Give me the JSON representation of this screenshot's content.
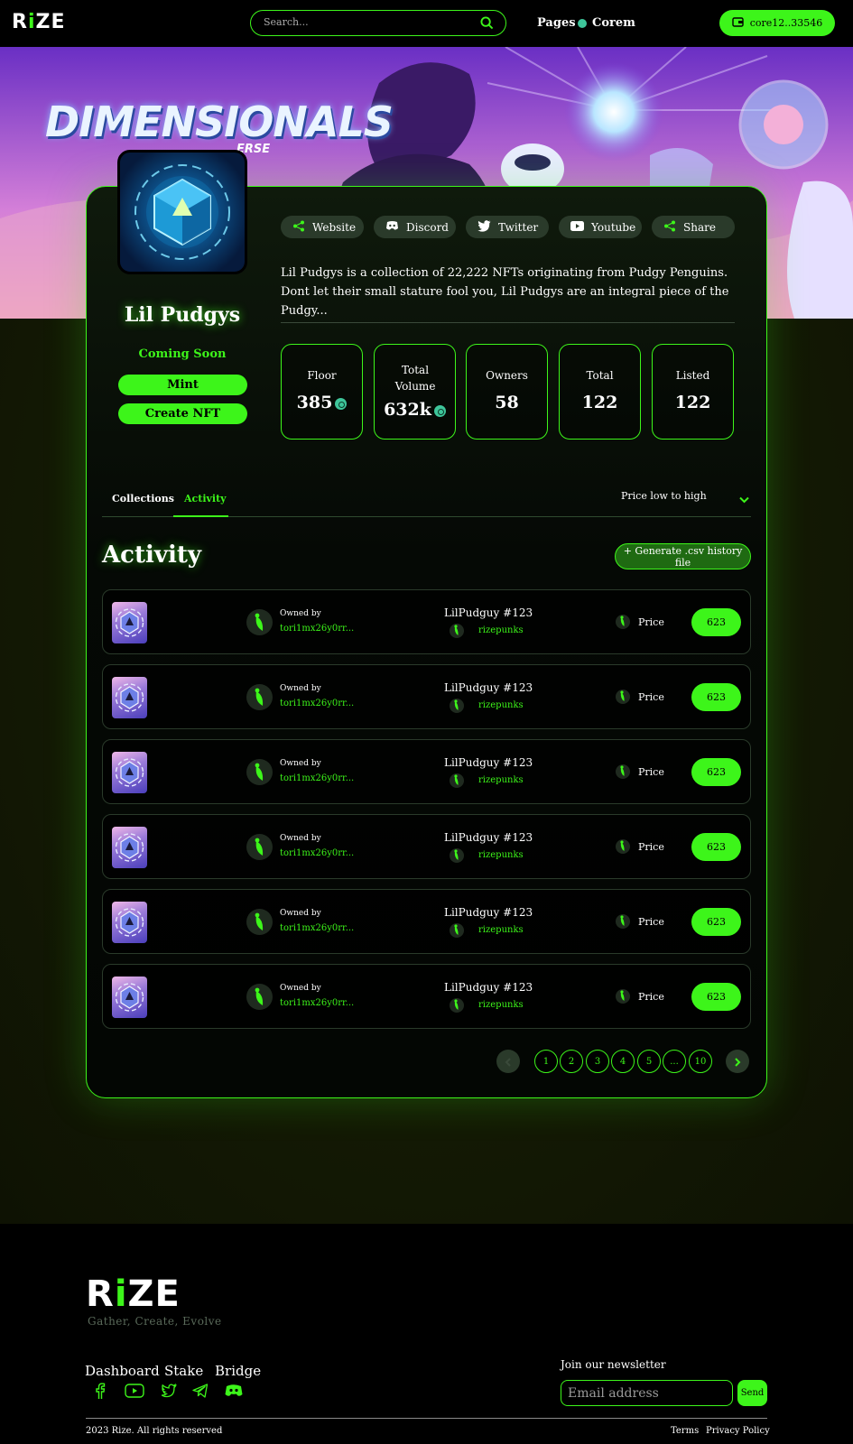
{
  "nav": {
    "logo": "RIZE",
    "search_placeholder": "Search...",
    "pages_label": "Pages",
    "network_label": "Corem",
    "wallet_label": "core12..33546"
  },
  "banner": {
    "title": "DIMENSIONALS",
    "subtitle": "ERSE"
  },
  "collection": {
    "name": "Lil Pudgys",
    "status": "Coming Soon",
    "mint_label": "Mint",
    "create_label": "Create NFT",
    "description": "Lil Pudgys is a collection of 22,222 NFTs originating from Pudgy Penguins. Dont let their small stature fool you, Lil Pudgys are an integral piece of the Pudgy..."
  },
  "social": [
    {
      "label": "Website",
      "icon": "share-icon"
    },
    {
      "label": "Discord",
      "icon": "discord-icon"
    },
    {
      "label": "Twitter",
      "icon": "twitter-icon"
    },
    {
      "label": "Youtube",
      "icon": "youtube-icon"
    },
    {
      "label": "Share",
      "icon": "share-icon"
    }
  ],
  "stats": [
    {
      "label": "Floor",
      "value": "385"
    },
    {
      "label": "Total Volume",
      "value": "632k"
    },
    {
      "label": "Owners",
      "value": "58"
    },
    {
      "label": "Total",
      "value": "122"
    },
    {
      "label": "Listed",
      "value": "122"
    }
  ],
  "tabs": [
    "Collections",
    "Activity"
  ],
  "active_tab": "Activity",
  "sort": {
    "selected": "Price low to high"
  },
  "activity": {
    "title": "Activity",
    "csv_button": "+ Generate .csv history file",
    "rows": [
      {
        "owned_label": "Owned by",
        "owner": "tori1mx26y0rr...",
        "item": "LilPudguy #123",
        "collection": "rizepunks",
        "price_label": "Price",
        "price": "623"
      },
      {
        "owned_label": "Owned by",
        "owner": "tori1mx26y0rr...",
        "item": "LilPudguy #123",
        "collection": "rizepunks",
        "price_label": "Price",
        "price": "623"
      },
      {
        "owned_label": "Owned by",
        "owner": "tori1mx26y0rr...",
        "item": "LilPudguy #123",
        "collection": "rizepunks",
        "price_label": "Price",
        "price": "623"
      },
      {
        "owned_label": "Owned by",
        "owner": "tori1mx26y0rr...",
        "item": "LilPudguy #123",
        "collection": "rizepunks",
        "price_label": "Price",
        "price": "623"
      },
      {
        "owned_label": "Owned by",
        "owner": "tori1mx26y0rr...",
        "item": "LilPudguy #123",
        "collection": "rizepunks",
        "price_label": "Price",
        "price": "623"
      },
      {
        "owned_label": "Owned by",
        "owner": "tori1mx26y0rr...",
        "item": "LilPudguy #123",
        "collection": "rizepunks",
        "price_label": "Price",
        "price": "623"
      }
    ]
  },
  "pagination": [
    "1",
    "2",
    "3",
    "4",
    "5",
    "...",
    "10"
  ],
  "footer": {
    "logo": "RIZE",
    "tagline": "Gather, Create, Evolve",
    "links": [
      "Dashboard",
      "Stake",
      "Bridge"
    ],
    "newsletter_title": "Join our newsletter",
    "email_placeholder": "Email address",
    "send_label": "Send",
    "copyright": "2023 Rize. All rights reserved",
    "terms": "Terms",
    "privacy": "Privacy Policy"
  },
  "colors": {
    "accent": "#3df51a",
    "background": "#000000",
    "coin": "#3ec59a"
  }
}
